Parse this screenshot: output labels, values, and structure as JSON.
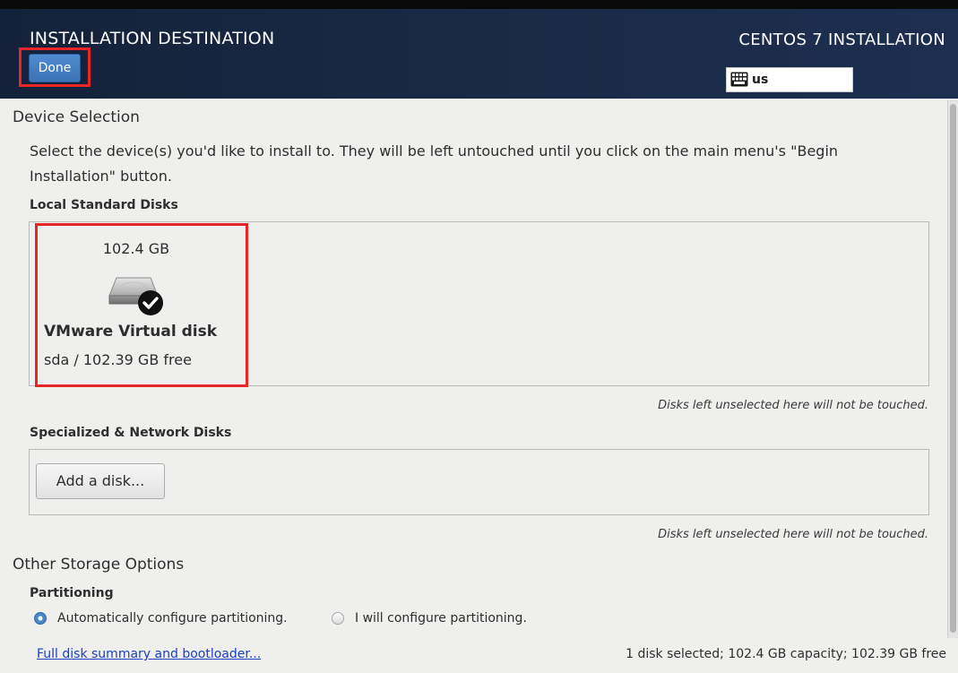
{
  "header": {
    "title": "INSTALLATION DESTINATION",
    "product": "CENTOS 7 INSTALLATION",
    "done_label": "Done",
    "keyboard_icon": "keyboard-icon",
    "keyboard_layout": "us"
  },
  "device_selection": {
    "heading": "Device Selection",
    "description": "Select the device(s) you'd like to install to.  They will be left untouched until you click on the main menu's \"Begin Installation\" button.",
    "local_disks": {
      "heading": "Local Standard Disks",
      "disks": [
        {
          "capacity": "102.4 GB",
          "name": "VMware Virtual disk",
          "free": "sda / 102.39 GB free",
          "selected": true,
          "icon": "hard-disk-icon"
        }
      ],
      "hint": "Disks left unselected here will not be touched."
    },
    "network_disks": {
      "heading": "Specialized & Network Disks",
      "add_label": "Add a disk...",
      "hint": "Disks left unselected here will not be touched."
    }
  },
  "other_storage": {
    "heading": "Other Storage Options",
    "partitioning": {
      "heading": "Partitioning",
      "options": [
        {
          "label": "Automatically configure partitioning.",
          "checked": true
        },
        {
          "label": "I will configure partitioning.",
          "checked": false
        }
      ]
    }
  },
  "footer": {
    "summary_link": "Full disk summary and bootloader...",
    "status": "1 disk selected; 102.4 GB capacity; 102.39 GB free"
  },
  "colors": {
    "header_bg": "#14213a",
    "done_button": "#3a73b6",
    "highlight": "#e8262a",
    "link": "#1a3fc4",
    "radio_selected": "#4a86c8"
  }
}
